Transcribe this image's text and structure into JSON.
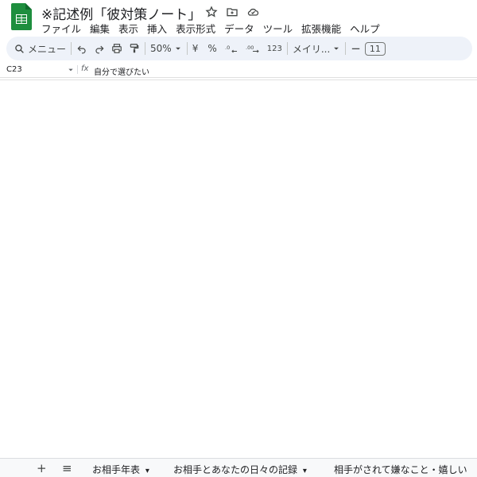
{
  "document": {
    "title": "※記述例「彼対策ノート」"
  },
  "menu": [
    "ファイル",
    "編集",
    "表示",
    "挿入",
    "表示形式",
    "データ",
    "ツール",
    "拡張機能",
    "ヘルプ"
  ],
  "toolbar": {
    "search_label": "メニュー",
    "zoom": "50%",
    "currency": "¥",
    "percent": "%",
    "number_format": "123",
    "font": "メイリ...",
    "font_size": "11"
  },
  "formula_bar": {
    "cell_ref": "C23",
    "fx": "fx",
    "content": "自分で選びたい"
  },
  "grid": {},
  "sheets": {
    "add": "+",
    "list": "≡",
    "tabs": [
      {
        "label": "お相手年表",
        "caret": "▾"
      },
      {
        "label": "お相手とあなたの日々の記録",
        "caret": "▾"
      },
      {
        "label": "相手がされて嫌なこと・嬉しい",
        "caret": ""
      }
    ]
  }
}
